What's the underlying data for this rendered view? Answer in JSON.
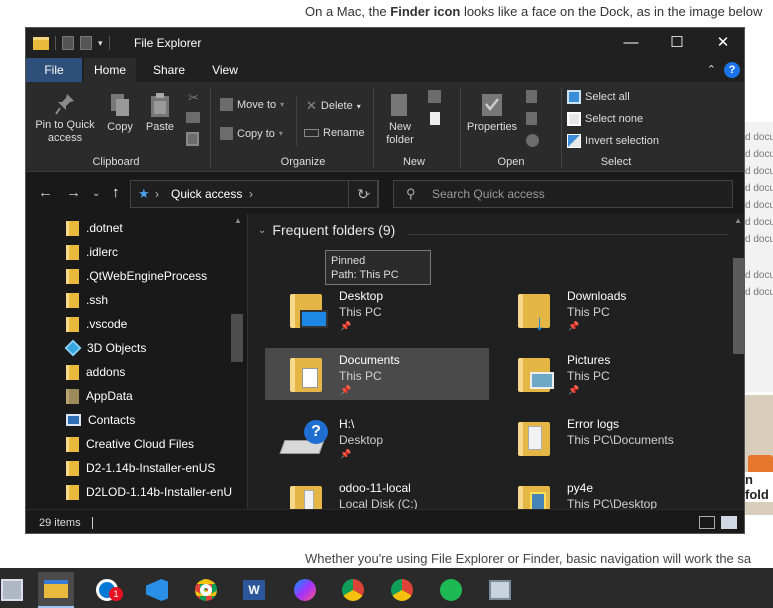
{
  "background_page": {
    "top_text_before": "On a Mac, the ",
    "top_text_bold": "Finder icon",
    "top_text_after": " looks like a face on the Dock, as in the image below",
    "right_snippets": [
      "d docu",
      "d docu",
      "d docu",
      "d docu",
      "d docu",
      "d docu",
      "d docu",
      "d docu",
      "d docu"
    ],
    "right_heading": "n fold",
    "bottom_text": "Whether you're using File Explorer or Finder, basic navigation will work the sa"
  },
  "window": {
    "title": "File Explorer",
    "controls": {
      "minimize": "—",
      "maximize": "☐",
      "close": "✕"
    },
    "help": "?"
  },
  "tabs": [
    {
      "label": "File"
    },
    {
      "label": "Home"
    },
    {
      "label": "Share"
    },
    {
      "label": "View"
    }
  ],
  "ribbon": {
    "clipboard": {
      "group_label": "Clipboard",
      "pin_label_1": "Pin to Quick",
      "pin_label_2": "access",
      "copy": "Copy",
      "paste": "Paste"
    },
    "organize": {
      "group_label": "Organize",
      "move_to": "Move to",
      "copy_to": "Copy to",
      "delete": "Delete",
      "rename": "Rename"
    },
    "new": {
      "group_label": "New",
      "new_folder_1": "New",
      "new_folder_2": "folder"
    },
    "open": {
      "group_label": "Open",
      "properties": "Properties"
    },
    "select": {
      "group_label": "Select",
      "select_all": "Select all",
      "select_none": "Select none",
      "invert": "Invert selection"
    }
  },
  "address": {
    "location": "Quick access",
    "search_placeholder": "Search Quick access"
  },
  "nav_pane": {
    "items": [
      {
        "label": ".dotnet",
        "icon": "folder-icon"
      },
      {
        "label": ".idlerc",
        "icon": "folder-icon"
      },
      {
        "label": ".QtWebEngineProcess",
        "icon": "folder-icon"
      },
      {
        "label": ".ssh",
        "icon": "folder-icon"
      },
      {
        "label": ".vscode",
        "icon": "folder-icon"
      },
      {
        "label": "3D Objects",
        "icon": "3d-objects-icon"
      },
      {
        "label": "addons",
        "icon": "folder-icon"
      },
      {
        "label": "AppData",
        "icon": "appdata-folder-icon"
      },
      {
        "label": "Contacts",
        "icon": "contacts-icon"
      },
      {
        "label": "Creative Cloud Files",
        "icon": "folder-icon"
      },
      {
        "label": "D2-1.14b-Installer-enUS",
        "icon": "folder-icon"
      },
      {
        "label": "D2LOD-1.14b-Installer-enU",
        "icon": "folder-icon"
      }
    ]
  },
  "frequent": {
    "header": "Frequent folders (9)",
    "folders": [
      {
        "name": "Desktop",
        "location": "This PC",
        "icon": "desktop-folder-icon"
      },
      {
        "name": "Downloads",
        "location": "This PC",
        "icon": "downloads-folder-icon"
      },
      {
        "name": "Documents",
        "location": "This PC",
        "icon": "documents-folder-icon"
      },
      {
        "name": "Pictures",
        "location": "This PC",
        "icon": "pictures-folder-icon"
      },
      {
        "name": "H:\\",
        "location": "Desktop",
        "icon": "drive-question-icon"
      },
      {
        "name": "Error logs",
        "location": "This PC\\Documents",
        "icon": "folder-icon"
      },
      {
        "name": "odoo-11-local",
        "location": "Local Disk (C:)",
        "icon": "folder-icon"
      },
      {
        "name": "py4e",
        "location": "This PC\\Desktop",
        "icon": "folder-icon"
      }
    ]
  },
  "tooltip": {
    "line1": "Pinned",
    "line2": "Path: This PC"
  },
  "status": {
    "item_count": "29 items"
  },
  "taskbar": {
    "apps": [
      {
        "name": "file-explorer",
        "active": true
      },
      {
        "name": "chat-app",
        "badge": "1"
      },
      {
        "name": "vscode"
      },
      {
        "name": "chrome"
      },
      {
        "name": "word"
      },
      {
        "name": "messenger"
      },
      {
        "name": "chrome-profile-1"
      },
      {
        "name": "chrome-profile-2"
      },
      {
        "name": "spotify"
      },
      {
        "name": "network-app"
      }
    ]
  },
  "colors": {
    "window_bg": "#191919",
    "ribbon_bg": "#2b2b2b",
    "file_tab": "#2d4f7a",
    "folder_yellow": "#e3b645",
    "accent_blue": "#1a73e8"
  }
}
